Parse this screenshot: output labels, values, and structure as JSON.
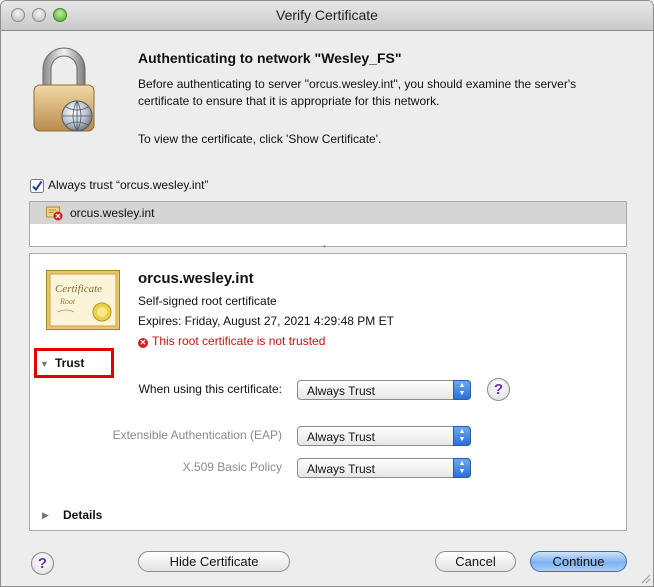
{
  "window": {
    "title": "Verify Certificate"
  },
  "header": {
    "heading": "Authenticating to network \"Wesley_FS\"",
    "description": "Before authenticating to server \"orcus.wesley.int\", you should examine the server's certificate to ensure that it is appropriate for this network.",
    "instruction": "To view the certificate, click 'Show Certificate'."
  },
  "always_trust": {
    "label": "Always trust “orcus.wesley.int”",
    "checked": true
  },
  "cert_list": {
    "items": [
      {
        "label": "orcus.wesley.int"
      }
    ]
  },
  "detail": {
    "name": "orcus.wesley.int",
    "type": "Self-signed root certificate",
    "expires": "Expires: Friday, August 27, 2021 4:29:48 PM ET",
    "warning": "This root certificate is not trusted",
    "trust_section": "Trust",
    "details_section": "Details",
    "rows": [
      {
        "label": "When using this certificate:",
        "value": "Always Trust"
      },
      {
        "label": "Extensible Authentication (EAP)",
        "value": "Always Trust"
      },
      {
        "label": "X.509 Basic Policy",
        "value": "Always Trust"
      }
    ]
  },
  "buttons": {
    "help": "?",
    "hide_certificate": "Hide Certificate",
    "cancel": "Cancel",
    "continue": "Continue"
  },
  "colors": {
    "highlight": "#e20000",
    "warning": "#cc1010",
    "default_button": "#7fb2ef"
  }
}
